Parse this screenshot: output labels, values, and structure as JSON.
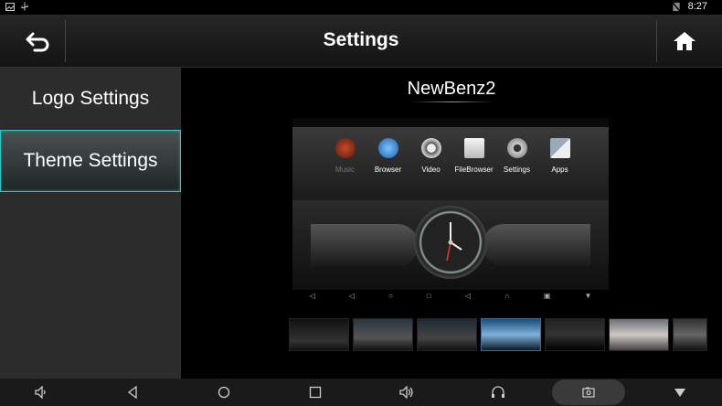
{
  "status_bar": {
    "time": "8:27"
  },
  "header": {
    "title": "Settings",
    "back_icon": "back-arrow-icon",
    "home_icon": "home-icon"
  },
  "sidebar": {
    "items": [
      {
        "label": "Logo Settings",
        "selected": false
      },
      {
        "label": "Theme Settings",
        "selected": true
      }
    ],
    "accent": "#2fc6c9"
  },
  "theme": {
    "name": "NewBenz2",
    "preview": {
      "apps": [
        {
          "label": "Music",
          "icon": "music-icon"
        },
        {
          "label": "Browser",
          "icon": "globe-icon"
        },
        {
          "label": "Video",
          "icon": "film-reel-icon"
        },
        {
          "label": "FileBrowser",
          "icon": "folder-icon"
        },
        {
          "label": "Settings",
          "icon": "gear-icon"
        },
        {
          "label": "Apps",
          "icon": "grid-icon"
        }
      ]
    }
  },
  "navbar": {
    "buttons": [
      "volume-down-icon",
      "back-icon",
      "home-circle-icon",
      "recents-icon",
      "volume-up-icon",
      "headphones-icon",
      "screenshot-icon",
      "dropdown-icon"
    ]
  }
}
